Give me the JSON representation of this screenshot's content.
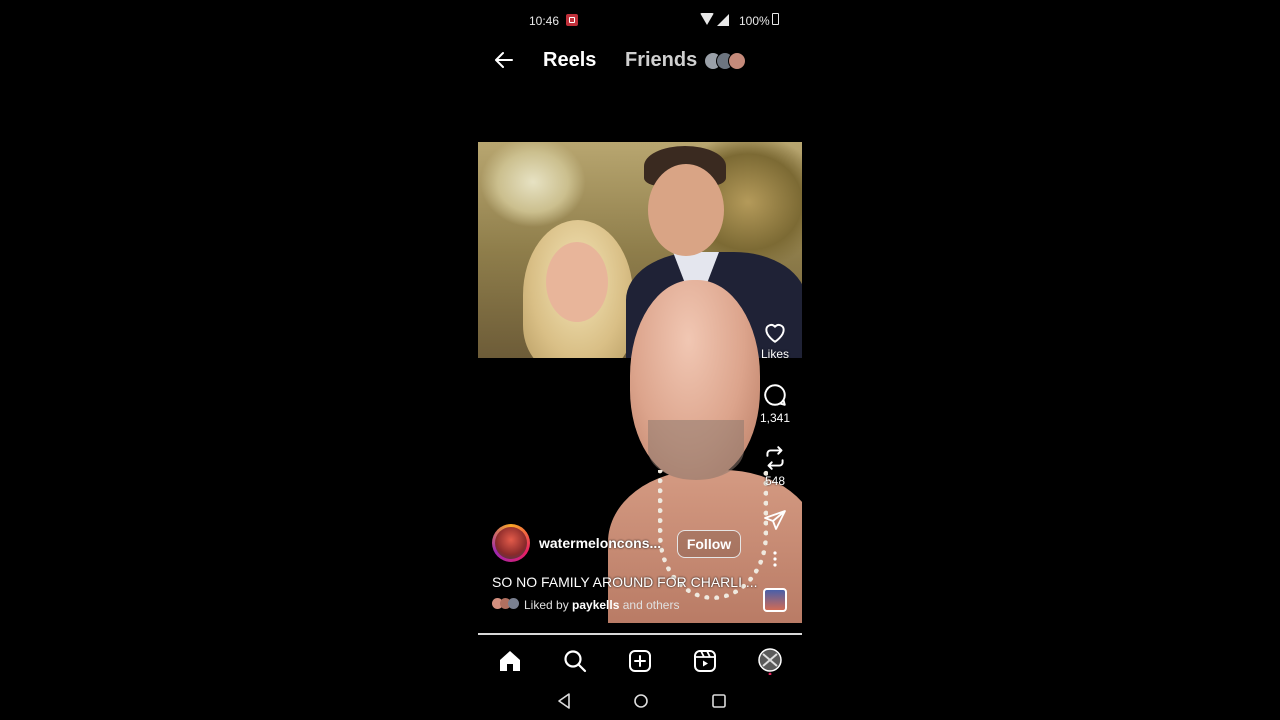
{
  "status_bar": {
    "time": "10:46",
    "battery_text": "100%",
    "icons": [
      "screen-record-icon",
      "wifi-icon",
      "signal-icon",
      "battery-icon"
    ]
  },
  "header": {
    "back_icon": "arrow-left-icon",
    "tab_reels": "Reels",
    "tab_friends": "Friends"
  },
  "actions": {
    "like_label": "Likes",
    "comments_count": "1,341",
    "reposts_count": "548"
  },
  "post": {
    "username": "watermeloncons...",
    "follow_label": "Follow",
    "caption": "SO NO FAMILY AROUND FOR CHARLI ...",
    "liked_prefix": "Liked by ",
    "liked_user": "paykells",
    "liked_suffix": " and others"
  },
  "progress": {
    "value": 1.0
  },
  "bottom_nav": [
    "home-icon",
    "search-icon",
    "create-icon",
    "reels-icon",
    "profile-avatar"
  ],
  "colors": {
    "background": "#000000",
    "text": "#ffffff",
    "record_badge": "#c0303a"
  }
}
